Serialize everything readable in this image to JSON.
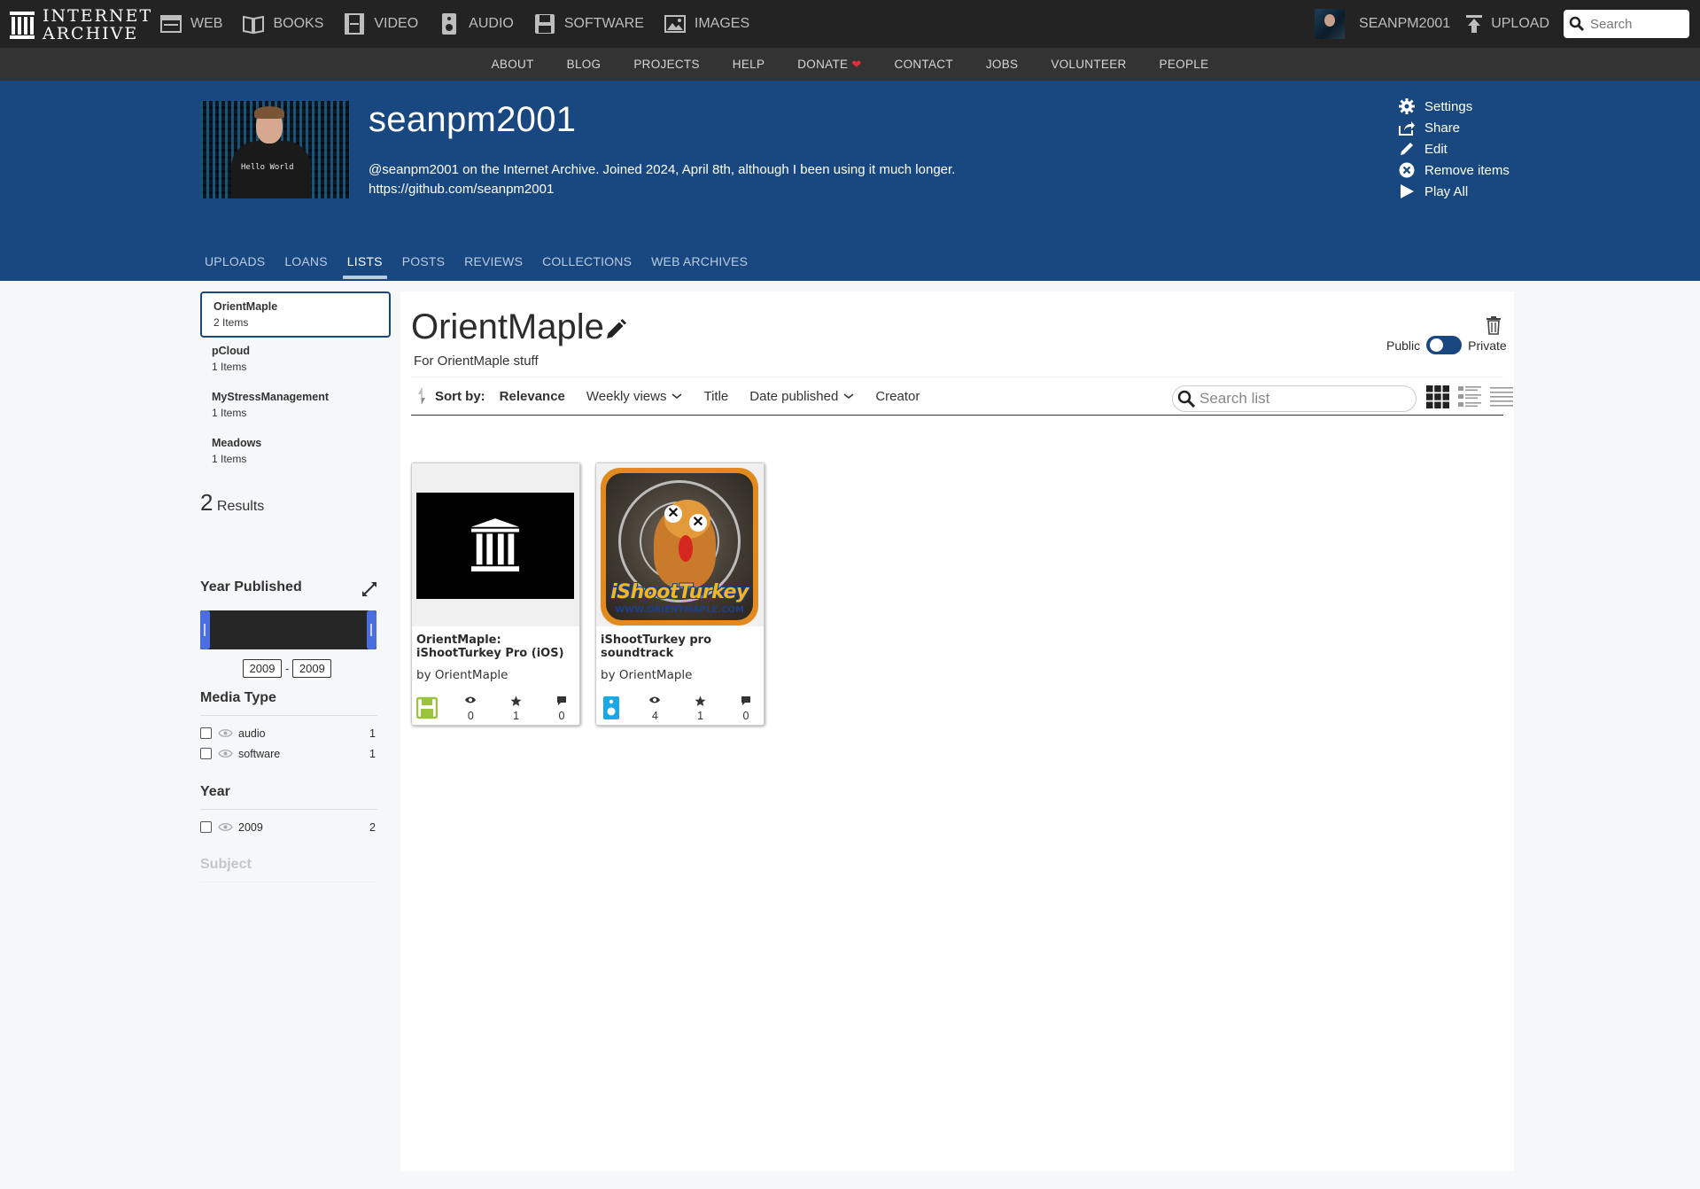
{
  "topnav": {
    "logo_line1": "INTERNET",
    "logo_line2": "ARCHIVE",
    "media": [
      {
        "label": "WEB",
        "icon": "web-icon"
      },
      {
        "label": "BOOKS",
        "icon": "books-icon"
      },
      {
        "label": "VIDEO",
        "icon": "video-icon"
      },
      {
        "label": "AUDIO",
        "icon": "audio-icon"
      },
      {
        "label": "SOFTWARE",
        "icon": "software-icon"
      },
      {
        "label": "IMAGES",
        "icon": "images-icon"
      }
    ],
    "username": "SEANPM2001",
    "upload_label": "UPLOAD",
    "search_placeholder": "Search"
  },
  "subnav": [
    "ABOUT",
    "BLOG",
    "PROJECTS",
    "HELP",
    "DONATE",
    "CONTACT",
    "JOBS",
    "VOLUNTEER",
    "PEOPLE"
  ],
  "profile": {
    "name": "seanpm2001",
    "bio_line1": "@seanpm2001 on the Internet Archive. Joined 2024, April 8th, although I been using it much longer.",
    "bio_line2": "https://github.com/seanpm2001",
    "avatar_shirt_text": "Hello World",
    "actions": [
      "Settings",
      "Share",
      "Edit",
      "Remove items",
      "Play All"
    ],
    "tabs": [
      "UPLOADS",
      "LOANS",
      "LISTS",
      "POSTS",
      "REVIEWS",
      "COLLECTIONS",
      "WEB ARCHIVES"
    ],
    "active_tab": "LISTS"
  },
  "sidebar": {
    "lists": [
      {
        "name": "OrientMaple",
        "count": "2 Items",
        "active": true
      },
      {
        "name": "pCloud",
        "count": "1 Items"
      },
      {
        "name": "MyStressManagement",
        "count": "1 Items"
      },
      {
        "name": "Meadows",
        "count": "1 Items"
      }
    ],
    "results_count": "2",
    "results_label": "Results",
    "year_published": {
      "title": "Year Published",
      "from": "2009",
      "to": "2009",
      "separator": "-"
    },
    "media_type": {
      "title": "Media Type",
      "rows": [
        {
          "label": "audio",
          "count": "1"
        },
        {
          "label": "software",
          "count": "1"
        }
      ]
    },
    "year": {
      "title": "Year",
      "rows": [
        {
          "label": "2009",
          "count": "2"
        }
      ]
    },
    "subject": {
      "title": "Subject"
    }
  },
  "main": {
    "title": "OrientMaple",
    "description": "For OrientMaple stuff",
    "public_label": "Public",
    "private_label": "Private",
    "sort_label": "Sort by:",
    "sort_options": [
      "Relevance",
      "Weekly views",
      "Title",
      "Date published",
      "Creator"
    ],
    "active_sort": "Relevance",
    "search_placeholder": "Search list",
    "items": [
      {
        "title": "OrientMaple: iShootTurkey Pro (iOS)",
        "creator": "by OrientMaple",
        "media_type_icon": "software-icon",
        "media_color": "#9ac43c",
        "views": "0",
        "favorites": "1",
        "reviews": "0"
      },
      {
        "title": "iShootTurkey pro soundtrack",
        "creator": "by OrientMaple",
        "media_type_icon": "audio-icon",
        "media_color": "#1aa7e6",
        "views": "4",
        "favorites": "1",
        "reviews": "0",
        "thumb_text": "iShootTurkey",
        "thumb_url": "WWW.ORIENTMAPLE.COM"
      }
    ]
  },
  "colors": {
    "topbar": "#232323",
    "subnav": "#333333",
    "profile_bg": "#194880",
    "accent": "#194880"
  }
}
